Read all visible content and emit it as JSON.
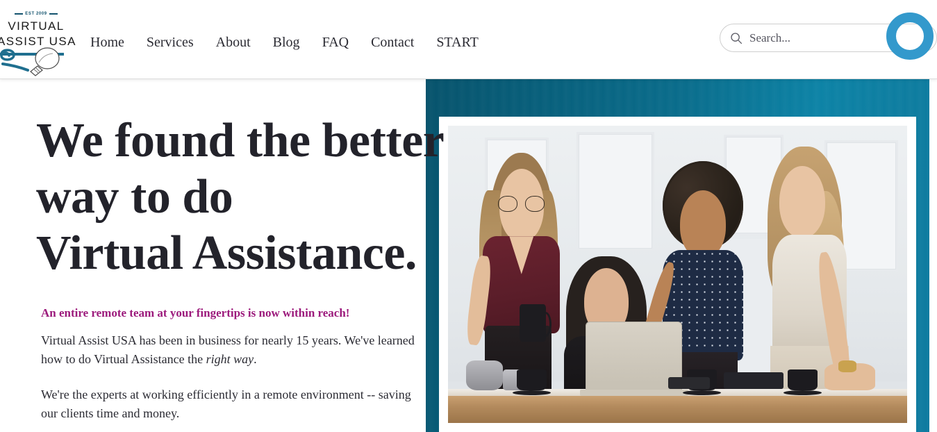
{
  "header": {
    "logo": {
      "est_text": "EST 2009",
      "line1": "VIRTUAL",
      "line2": "ASSIST USA",
      "icon": "lightbulb-icon",
      "brand_color": "#13536e"
    },
    "nav": [
      {
        "label": "Home"
      },
      {
        "label": "Services"
      },
      {
        "label": "About"
      },
      {
        "label": "Blog"
      },
      {
        "label": "FAQ"
      },
      {
        "label": "Contact"
      },
      {
        "label": "START"
      }
    ],
    "search": {
      "icon": "search-icon",
      "placeholder": "Search...",
      "value": ""
    },
    "accent_circle_color": "#3399cc"
  },
  "hero": {
    "heading_line1": "We found the better",
    "heading_line2": "way to do",
    "heading_line3": "Virtual Assistance.",
    "tagline": "An entire remote team at your fingertips is now within reach!",
    "tagline_color": "#9c1a7c",
    "paragraph1_part1": "Virtual Assist USA has been in business for nearly 15 years. We've learned how to do Virtual Assistance the ",
    "paragraph1_emphasis": "right way",
    "paragraph1_part2": ".",
    "paragraph2": "We're the experts at working efficiently in a remote environment -- saving our clients time and money.",
    "panel_gradient_start": "#07536c",
    "panel_gradient_end": "#0f7ba0",
    "photo_alt": "Four businesswomen around a desk with a laptop in a bright white office"
  }
}
